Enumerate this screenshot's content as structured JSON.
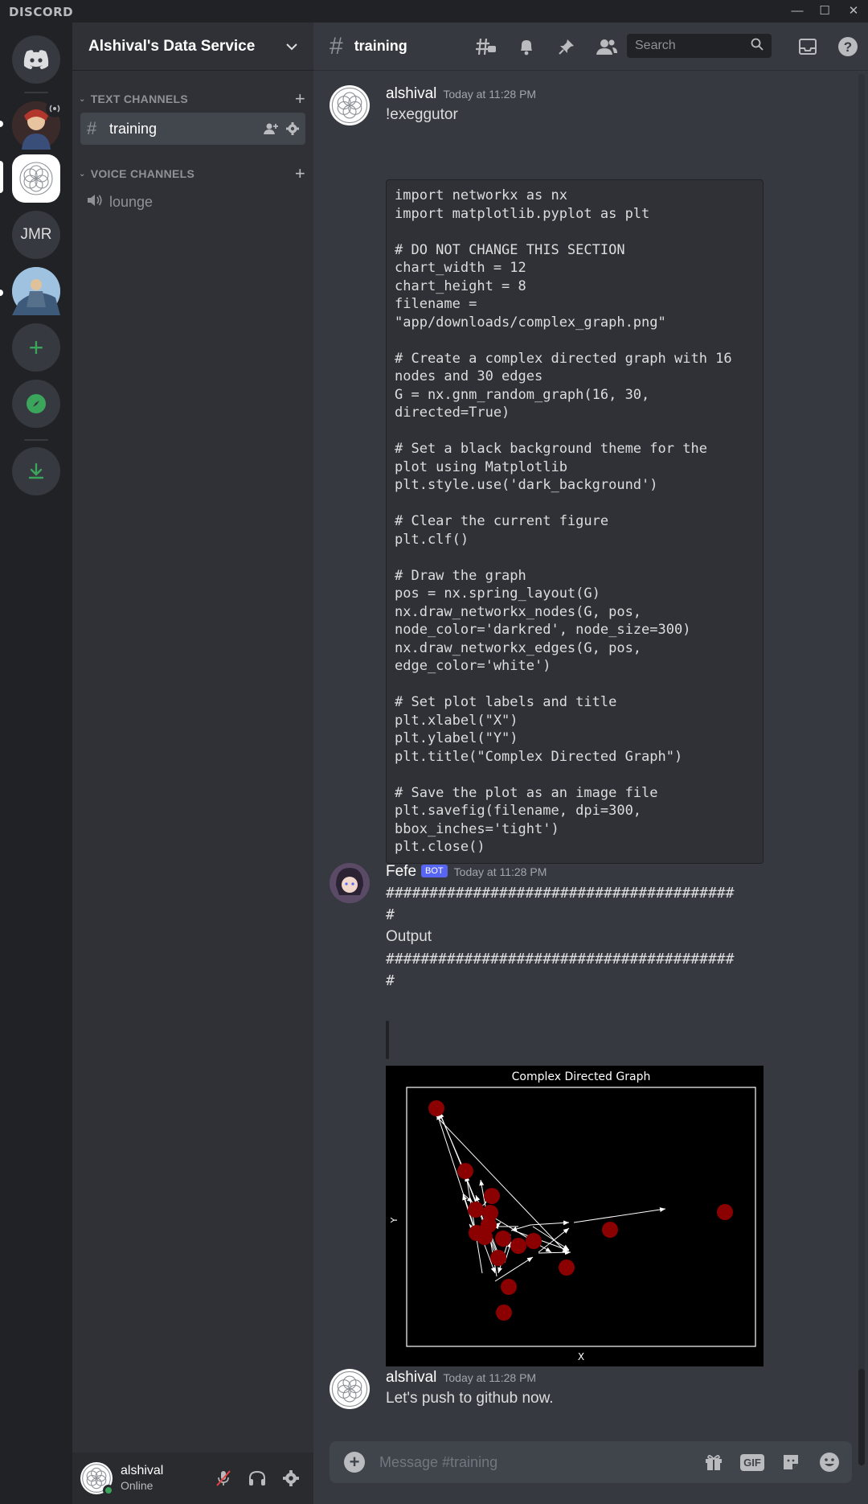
{
  "app": {
    "brand": "DISCORD",
    "window_controls": {
      "minimize": "—",
      "maximize": "☐",
      "close": "✕"
    }
  },
  "servers": [
    {
      "name": "home",
      "icon": "discord-logo-icon"
    },
    {
      "name": "server-avatar-1",
      "icon": "avatar-icon"
    },
    {
      "name": "alshivals-data-service",
      "icon": "flower-icon",
      "active": true
    },
    {
      "name": "jmr",
      "label": "JMR"
    },
    {
      "name": "server-avatar-4",
      "icon": "avatar-icon"
    },
    {
      "name": "add-server",
      "icon": "plus-icon"
    },
    {
      "name": "explore",
      "icon": "compass-icon"
    },
    {
      "name": "download",
      "icon": "download-icon"
    }
  ],
  "guild": {
    "name": "Alshival's Data Service"
  },
  "categories": {
    "text": {
      "label": "TEXT CHANNELS"
    },
    "voice": {
      "label": "VOICE CHANNELS"
    }
  },
  "channels": {
    "training": {
      "label": "training"
    },
    "lounge": {
      "label": "lounge"
    }
  },
  "header": {
    "channel": "training",
    "search_placeholder": "Search"
  },
  "messages": {
    "m1": {
      "author": "alshival",
      "timestamp": "Today at 11:28 PM",
      "text": "!exeggutor",
      "code": [
        "import networkx as nx",
        "import matplotlib.pyplot as plt",
        "",
        "# DO NOT CHANGE THIS SECTION",
        "chart_width = 12",
        "chart_height = 8",
        "filename =",
        "\"app/downloads/complex_graph.png\"",
        "",
        "# Create a complex directed graph with 16",
        "nodes and 30 edges",
        "G = nx.gnm_random_graph(16, 30,",
        "directed=True)",
        "",
        "# Set a black background theme for the",
        "plot using Matplotlib",
        "plt.style.use('dark_background')",
        "",
        "# Clear the current figure",
        "plt.clf()",
        "",
        "# Draw the graph",
        "pos = nx.spring_layout(G)",
        "nx.draw_networkx_nodes(G, pos,",
        "node_color='darkred', node_size=300)",
        "nx.draw_networkx_edges(G, pos,",
        "edge_color='white')",
        "",
        "# Set plot labels and title",
        "plt.xlabel(\"X\")",
        "plt.ylabel(\"Y\")",
        "plt.title(\"Complex Directed Graph\")",
        "",
        "# Save the plot as an image file",
        "plt.savefig(filename, dpi=300,",
        "bbox_inches='tight')",
        "plt.close()"
      ]
    },
    "m2": {
      "author": "Fefe",
      "bot_tag": "BOT",
      "timestamp": "Today at 11:28 PM",
      "lines": [
        "########################################",
        "#",
        "Output",
        "########################################",
        "#"
      ],
      "image": {
        "title": "Complex Directed Graph",
        "xlabel": "X",
        "ylabel": "Y"
      }
    },
    "m3": {
      "author": "alshival",
      "timestamp": "Today at 11:28 PM",
      "text": "Let's push to github now."
    }
  },
  "composer": {
    "placeholder": "Message #training",
    "gif_label": "GIF"
  },
  "user": {
    "name": "alshival",
    "status": "Online"
  },
  "colors": {
    "accent": "#5865f2",
    "online": "#3ba55c",
    "node": "#8b0000"
  }
}
